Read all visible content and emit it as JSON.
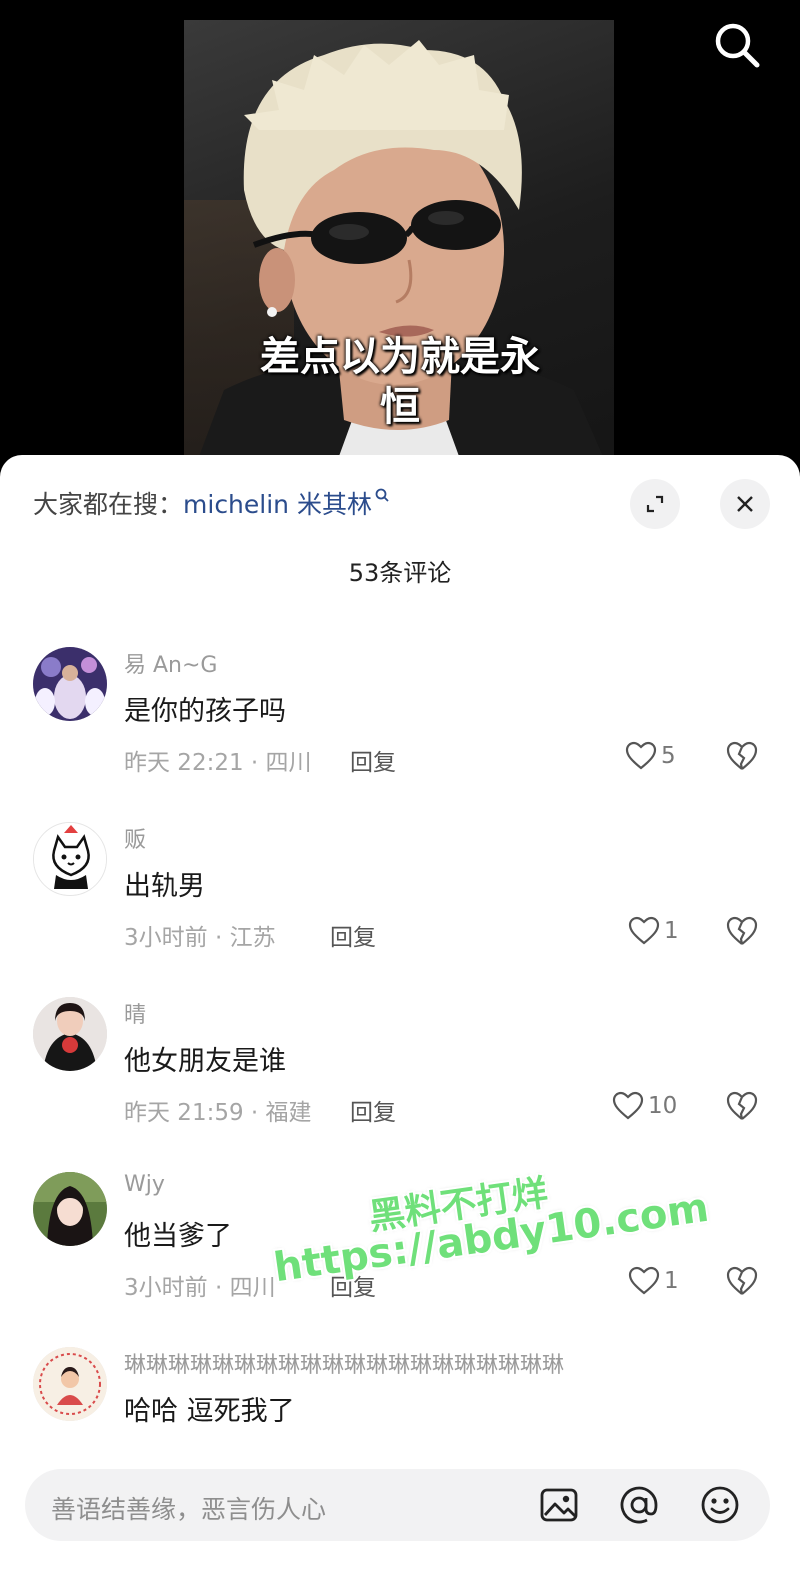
{
  "video": {
    "subtitle_line1": "差点以为就是永",
    "subtitle_line2": "恒"
  },
  "header": {
    "hot_search_prefix": "大家都在搜：",
    "hot_search_keyword": "michelin 米其林",
    "comment_count": "53条评论"
  },
  "comments": [
    {
      "user": "易 An~G",
      "text": "是你的孩子吗",
      "time_location": "昨天 22:21 · 四川",
      "reply": "回复",
      "likes": "5"
    },
    {
      "user": "贩",
      "text": "出轨男",
      "time_location": "3小时前 · 江苏",
      "reply": "回复",
      "likes": "1"
    },
    {
      "user": "晴",
      "text": "他女朋友是谁",
      "time_location": "昨天 21:59 · 福建",
      "reply": "回复",
      "likes": "10"
    },
    {
      "user": "Wjy",
      "text": "他当爹了",
      "time_location": "3小时前 · 四川",
      "reply": "回复",
      "likes": "1"
    },
    {
      "user": "琳琳琳琳琳琳琳琳琳琳琳琳琳琳琳琳琳琳琳琳",
      "text": "哈哈 逗死我了",
      "time_location": "",
      "reply": "",
      "likes": ""
    }
  ],
  "watermark": {
    "line1": "黑料不打烊",
    "line2": "https://abdy10.com"
  },
  "input": {
    "placeholder": "善语结善缘，恶言伤人心"
  },
  "colors": {
    "keyword": "#2b4c8c",
    "watermark": "#6fe07a",
    "sheet_bg": "#ffffff"
  },
  "icons": [
    "search-icon",
    "expand-icon",
    "close-icon",
    "heart-icon",
    "broken-heart-icon",
    "image-icon",
    "at-icon",
    "emoji-icon"
  ]
}
